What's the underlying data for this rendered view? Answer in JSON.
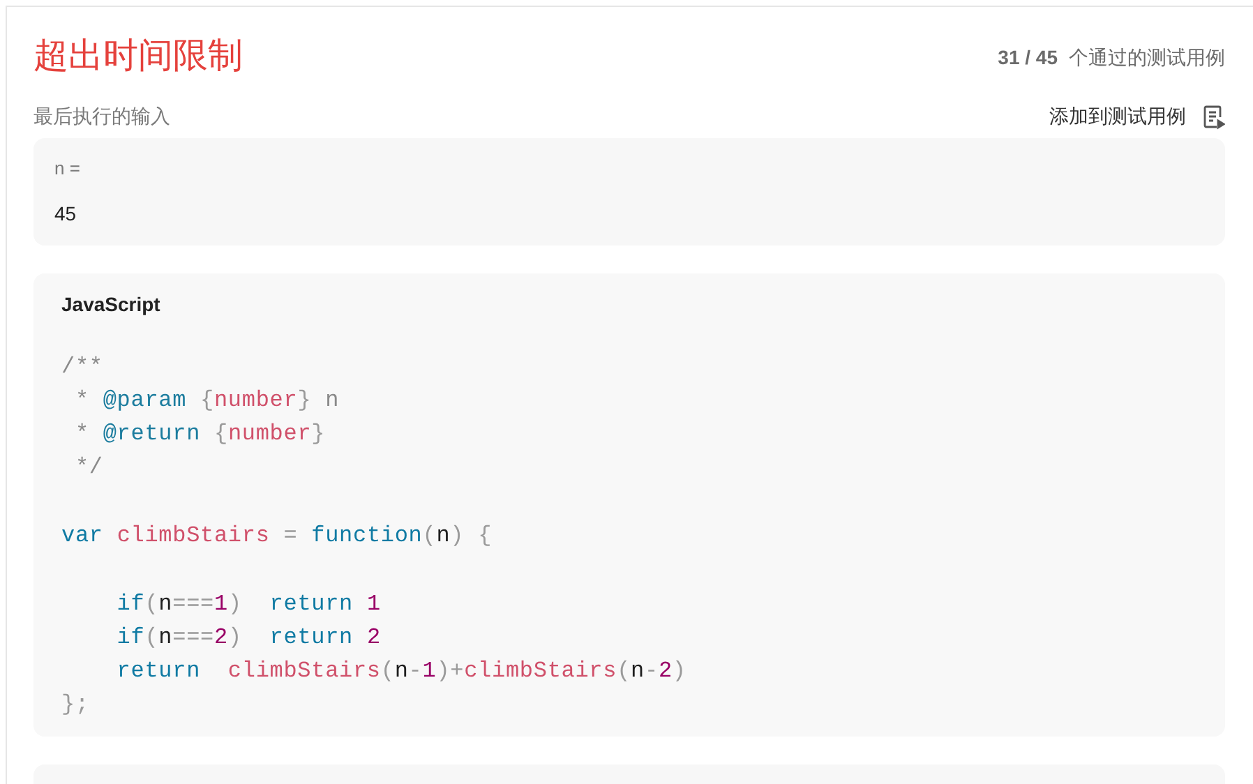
{
  "result": {
    "title": "超出时间限制",
    "passed": "31 / 45",
    "passed_label": "个通过的测试用例"
  },
  "last_input": {
    "label": "最后执行的输入",
    "add_button": "添加到测试用例",
    "params": [
      {
        "name": "n =",
        "value": "45"
      }
    ]
  },
  "code": {
    "language": "JavaScript",
    "lines": [
      {
        "tokens": [
          {
            "kind": "comment",
            "text": "/**"
          }
        ]
      },
      {
        "tokens": [
          {
            "kind": "comment",
            "text": " * "
          },
          {
            "kind": "tag",
            "text": "@param"
          },
          {
            "kind": "punct",
            "text": " {"
          },
          {
            "kind": "type",
            "text": "number"
          },
          {
            "kind": "punct",
            "text": "} "
          },
          {
            "kind": "comment",
            "text": "n"
          }
        ]
      },
      {
        "tokens": [
          {
            "kind": "comment",
            "text": " * "
          },
          {
            "kind": "tag",
            "text": "@return"
          },
          {
            "kind": "punct",
            "text": " {"
          },
          {
            "kind": "type",
            "text": "number"
          },
          {
            "kind": "punct",
            "text": "}"
          }
        ]
      },
      {
        "tokens": [
          {
            "kind": "comment",
            "text": " */"
          }
        ]
      },
      {
        "kind": "blank"
      },
      {
        "tokens": [
          {
            "kind": "keyword",
            "text": "var "
          },
          {
            "kind": "name",
            "text": "climbStairs"
          },
          {
            "kind": "punct",
            "text": " = "
          },
          {
            "kind": "keyword",
            "text": "function"
          },
          {
            "kind": "punct",
            "text": "("
          },
          {
            "kind": "plain",
            "text": "n"
          },
          {
            "kind": "punct",
            "text": ") {"
          }
        ]
      },
      {
        "kind": "blank"
      },
      {
        "tokens": [
          {
            "kind": "keyword",
            "text": "    if"
          },
          {
            "kind": "punct",
            "text": "("
          },
          {
            "kind": "plain",
            "text": "n"
          },
          {
            "kind": "punct",
            "text": "==="
          },
          {
            "kind": "number",
            "text": "1"
          },
          {
            "kind": "punct",
            "text": ")  "
          },
          {
            "kind": "keyword",
            "text": "return "
          },
          {
            "kind": "number",
            "text": "1"
          }
        ]
      },
      {
        "tokens": [
          {
            "kind": "keyword",
            "text": "    if"
          },
          {
            "kind": "punct",
            "text": "("
          },
          {
            "kind": "plain",
            "text": "n"
          },
          {
            "kind": "punct",
            "text": "==="
          },
          {
            "kind": "number",
            "text": "2"
          },
          {
            "kind": "punct",
            "text": ")  "
          },
          {
            "kind": "keyword",
            "text": "return "
          },
          {
            "kind": "number",
            "text": "2"
          }
        ]
      },
      {
        "tokens": [
          {
            "kind": "keyword",
            "text": "    return  "
          },
          {
            "kind": "name",
            "text": "climbStairs"
          },
          {
            "kind": "punct",
            "text": "("
          },
          {
            "kind": "plain",
            "text": "n"
          },
          {
            "kind": "punct",
            "text": "-"
          },
          {
            "kind": "number",
            "text": "1"
          },
          {
            "kind": "punct",
            "text": ")+"
          },
          {
            "kind": "name",
            "text": "climbStairs"
          },
          {
            "kind": "punct",
            "text": "("
          },
          {
            "kind": "plain",
            "text": "n"
          },
          {
            "kind": "punct",
            "text": "-"
          },
          {
            "kind": "number",
            "text": "2"
          },
          {
            "kind": "punct",
            "text": ")"
          }
        ]
      },
      {
        "tokens": [
          {
            "kind": "punct",
            "text": "};"
          }
        ]
      }
    ]
  }
}
